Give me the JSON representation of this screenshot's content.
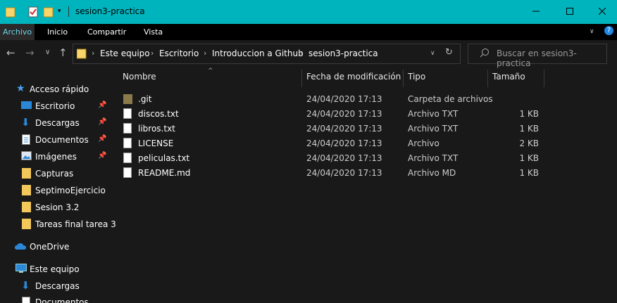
{
  "window": {
    "title": "sesion3-practica",
    "controls": [
      "minimize-icon",
      "maximize-icon",
      "close-icon"
    ]
  },
  "ribbon": {
    "tabs": [
      {
        "label": "Archivo",
        "active": true
      },
      {
        "label": "Inicio",
        "active": false
      },
      {
        "label": "Compartir",
        "active": false
      },
      {
        "label": "Vista",
        "active": false
      }
    ]
  },
  "address": {
    "crumbs": [
      "Este equipo",
      "Escritorio",
      "Introduccion a Github",
      "sesion3-practica"
    ]
  },
  "search": {
    "placeholder": "Buscar en sesion3-practica"
  },
  "columns": {
    "name": "Nombre",
    "date": "Fecha de modificación",
    "type": "Tipo",
    "size": "Tamaño"
  },
  "sidebar": {
    "items": [
      {
        "label": "Acceso rápido",
        "icon": "star-icon",
        "pinned": false
      },
      {
        "label": "Escritorio",
        "icon": "desktop-icon",
        "pinned": true
      },
      {
        "label": "Descargas",
        "icon": "download-icon",
        "pinned": true
      },
      {
        "label": "Documentos",
        "icon": "document-icon",
        "pinned": true
      },
      {
        "label": "Imágenes",
        "icon": "image-icon",
        "pinned": true
      },
      {
        "label": "Capturas",
        "icon": "folder-icon",
        "pinned": false
      },
      {
        "label": "SeptimoEjercicio",
        "icon": "folder-icon",
        "pinned": false
      },
      {
        "label": "Sesion 3.2",
        "icon": "folder-icon",
        "pinned": false
      },
      {
        "label": "Tareas final tarea 3",
        "icon": "folder-icon",
        "pinned": false
      },
      {
        "label": "OneDrive",
        "icon": "cloud-icon",
        "pinned": false
      },
      {
        "label": "Este equipo",
        "icon": "computer-icon",
        "pinned": false
      },
      {
        "label": "Descargas",
        "icon": "download-icon",
        "pinned": false
      },
      {
        "label": "Documentos",
        "icon": "document-icon",
        "pinned": false
      }
    ]
  },
  "files": [
    {
      "name": ".git",
      "date": "24/04/2020 17:13",
      "type": "Carpeta de archivos",
      "size": "",
      "icon": "folder-icon"
    },
    {
      "name": "discos.txt",
      "date": "24/04/2020 17:13",
      "type": "Archivo TXT",
      "size": "1 KB",
      "icon": "text-file-icon"
    },
    {
      "name": "libros.txt",
      "date": "24/04/2020 17:13",
      "type": "Archivo TXT",
      "size": "1 KB",
      "icon": "text-file-icon"
    },
    {
      "name": "LICENSE",
      "date": "24/04/2020 17:13",
      "type": "Archivo",
      "size": "2 KB",
      "icon": "file-icon"
    },
    {
      "name": "peliculas.txt",
      "date": "24/04/2020 17:13",
      "type": "Archivo TXT",
      "size": "1 KB",
      "icon": "text-file-icon"
    },
    {
      "name": "README.md",
      "date": "24/04/2020 17:13",
      "type": "Archivo MD",
      "size": "1 KB",
      "icon": "file-icon"
    }
  ],
  "colors": {
    "titlebar": "#00b4bd",
    "accent_tab": "#6fd3e8",
    "background": "#191919"
  }
}
